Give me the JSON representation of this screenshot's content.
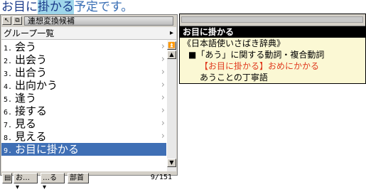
{
  "composition": {
    "converted": "お目に",
    "selected": "掛かる",
    "rest": "予定です。"
  },
  "candidate_window": {
    "title": "連想変換候補",
    "group_label": "グループ一覧",
    "items": [
      {
        "num": "1.",
        "text": "会う"
      },
      {
        "num": "2.",
        "text": "出会う"
      },
      {
        "num": "3.",
        "text": "出合う"
      },
      {
        "num": "4.",
        "text": "出向かう"
      },
      {
        "num": "5.",
        "text": "逢う"
      },
      {
        "num": "6.",
        "text": "接する"
      },
      {
        "num": "7.",
        "text": "見る"
      },
      {
        "num": "8.",
        "text": "見える"
      },
      {
        "num": "9.",
        "text": "お目に掛かる"
      }
    ],
    "selected_index": 8,
    "bottom": {
      "btn_a": "お…",
      "btn_b": "…る",
      "btn_c": "部首",
      "count": "9/151"
    }
  },
  "dictionary": {
    "headword": "お目に掛かる",
    "lines": [
      "《日本語使いさばき辞典》",
      "■「あう」に関する動詞・複合動詞",
      "【お目に掛かる】おめにかかる",
      "あうことの丁寧語"
    ]
  },
  "colors": {
    "selection": "#3f6fb5",
    "highlight": "#9ed6ea",
    "dict_bg": "#fbf8d4",
    "dict_red": "#e03a1e"
  }
}
